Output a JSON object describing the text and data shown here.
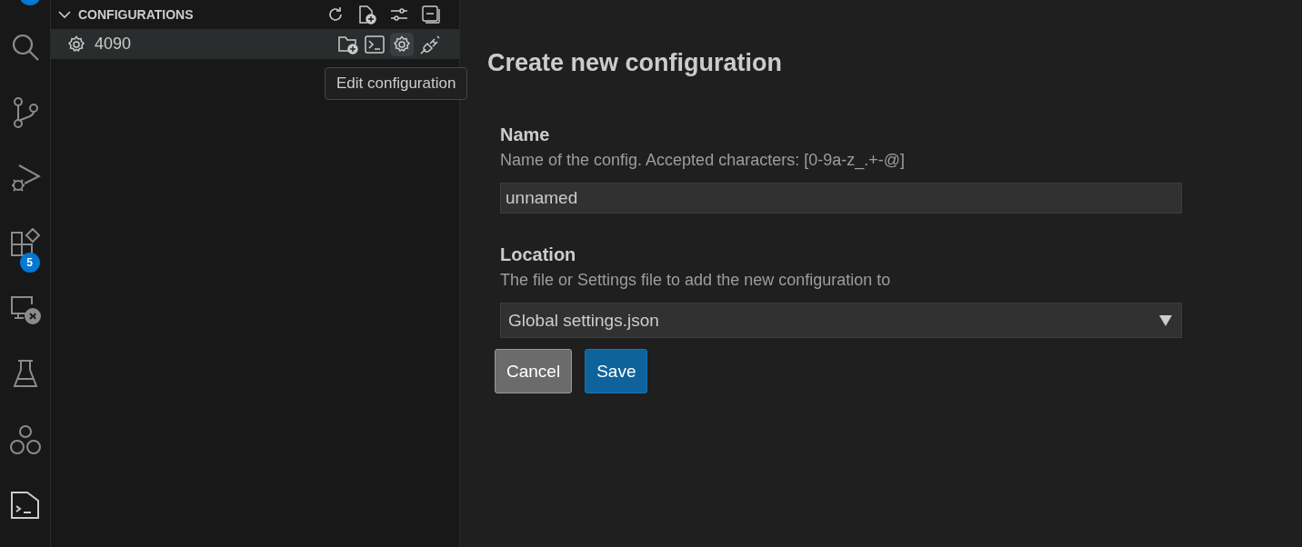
{
  "activity_bar": {
    "badge": "5"
  },
  "sidebar": {
    "section_title": "CONFIGURATIONS",
    "expanded": true,
    "items": [
      {
        "label": "4090",
        "hovered": true
      }
    ],
    "tooltip": "Edit configuration"
  },
  "form": {
    "title": "Create new configuration",
    "name": {
      "label": "Name",
      "description": "Name of the config. Accepted characters: [0-9a-z_.+-@]",
      "value": "unnamed"
    },
    "location": {
      "label": "Location",
      "description": "The file or Settings file to add the new configuration to",
      "value": "Global settings.json"
    },
    "buttons": [
      {
        "label": "Cancel",
        "kind": "secondary"
      },
      {
        "label": "Save",
        "kind": "primary"
      }
    ]
  }
}
